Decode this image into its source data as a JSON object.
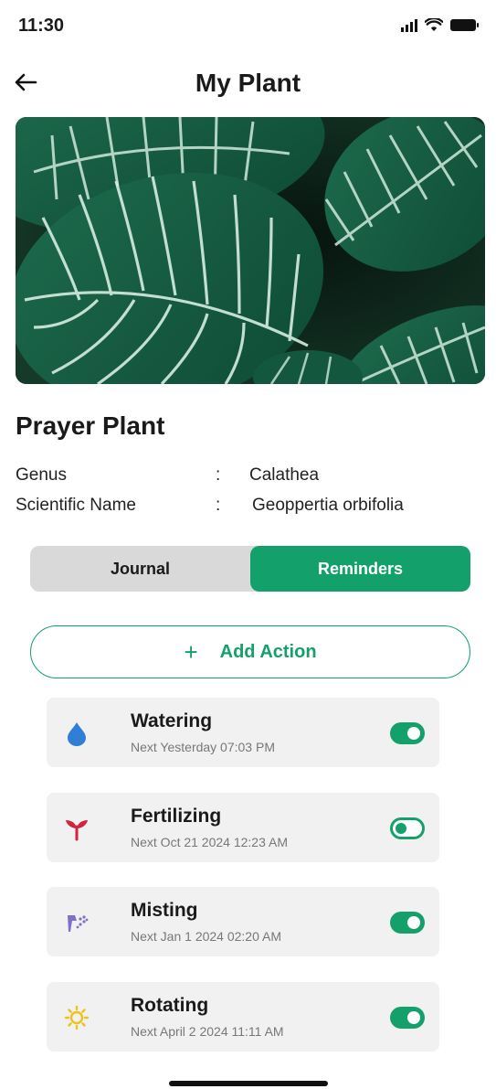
{
  "status_bar": {
    "time": "11:30"
  },
  "header": {
    "title": "My Plant"
  },
  "plant": {
    "name": "Prayer Plant",
    "details": [
      {
        "label": "Genus",
        "separator": ":",
        "value": "Calathea"
      },
      {
        "label": "Scientific Name",
        "separator": ":",
        "value": "Geoppertia orbifolia"
      }
    ]
  },
  "tabs": [
    {
      "label": "Journal",
      "active": false
    },
    {
      "label": "Reminders",
      "active": true
    }
  ],
  "add_action": {
    "icon": "+",
    "label": "Add Action"
  },
  "reminders": [
    {
      "title": "Watering",
      "subtitle": "Next Yesterday  07:03 PM",
      "icon": "water-drop-icon",
      "icon_color": "#2f7fd6",
      "enabled": true
    },
    {
      "title": "Fertilizing",
      "subtitle": "Next Oct 21 2024  12:23 AM",
      "icon": "sprout-icon",
      "icon_color": "#d0263c",
      "enabled": false
    },
    {
      "title": "Misting",
      "subtitle": "Next Jan 1 2024  02:20 AM",
      "icon": "spray-bottle-icon",
      "icon_color": "#7b71c9",
      "enabled": true
    },
    {
      "title": "Rotating",
      "subtitle": "Next April 2 2024  11:11 AM",
      "icon": "sun-icon",
      "icon_color": "#f2c21b",
      "enabled": true
    }
  ],
  "colors": {
    "accent": "#14a06a",
    "tab_inactive_bg": "#d9d9d9",
    "card_bg": "#f1f1f1"
  }
}
